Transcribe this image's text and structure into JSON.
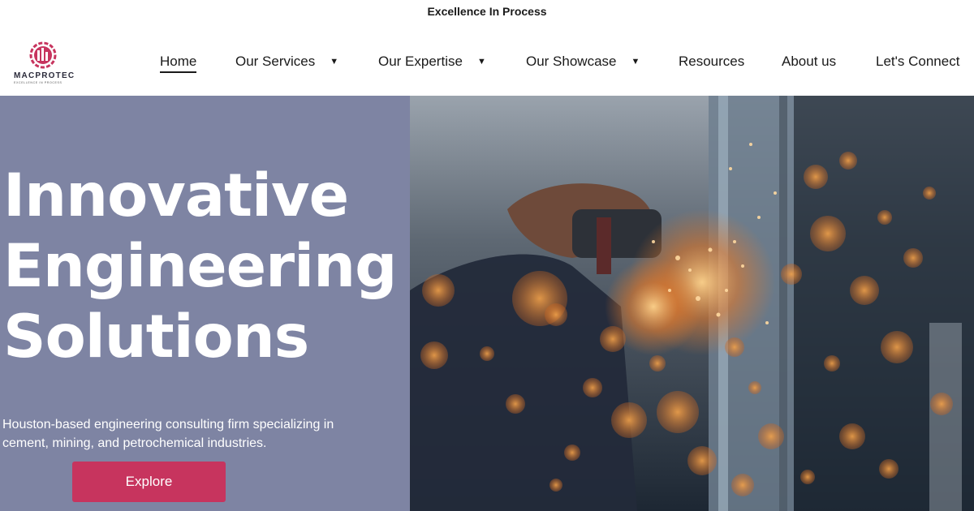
{
  "header": {
    "tagline": "Excellence In Process",
    "logo": {
      "name": "MACPROTEC",
      "subtitle": "EXCELLENCE IN PROCESS",
      "icon": "gear-factory-logo-icon",
      "color": "#c7345e"
    }
  },
  "nav": {
    "items": [
      {
        "label": "Home",
        "active": true,
        "has_dropdown": false
      },
      {
        "label": "Our Services",
        "active": false,
        "has_dropdown": true
      },
      {
        "label": "Our Expertise",
        "active": false,
        "has_dropdown": true
      },
      {
        "label": "Our Showcase",
        "active": false,
        "has_dropdown": true
      },
      {
        "label": "Resources",
        "active": false,
        "has_dropdown": false
      },
      {
        "label": "About us",
        "active": false,
        "has_dropdown": false
      },
      {
        "label": "Let's Connect",
        "active": false,
        "has_dropdown": false
      }
    ],
    "dropdown_icon": "caret-down-icon"
  },
  "hero": {
    "title_lines": [
      "Innovative",
      "Engineering",
      "Solutions"
    ],
    "description": "Houston-based engineering consulting firm specializing in cement, mining, and petrochemical industries.",
    "cta_label": "Explore",
    "image_description_icon": "angle-grinder-sparks-photo",
    "panel_color": "#7e84a3",
    "button_color": "#c7345e"
  }
}
